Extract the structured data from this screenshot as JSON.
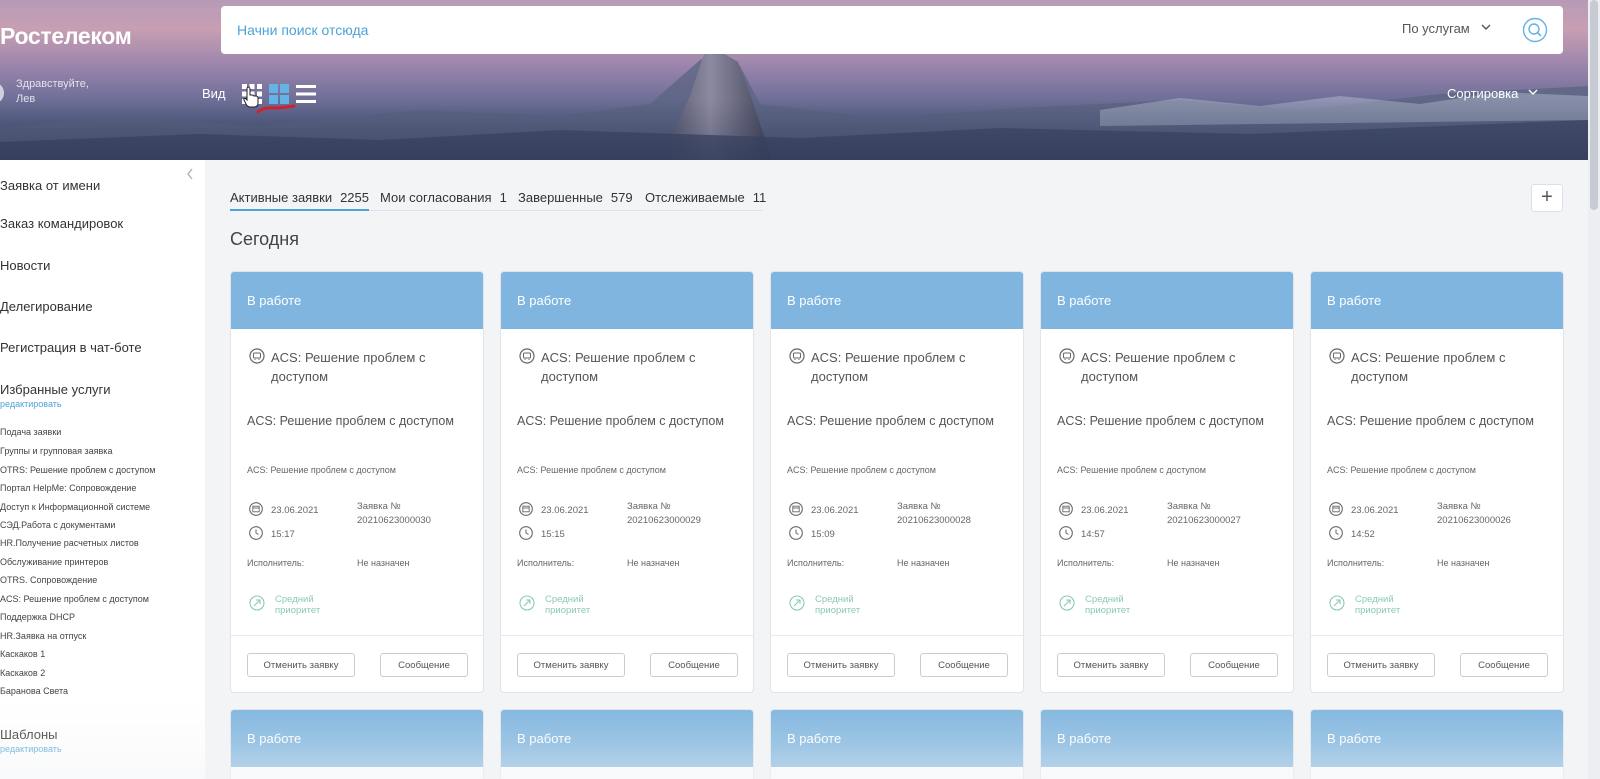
{
  "header": {
    "logo": "Ростелеком",
    "greeting_line1": "Здравствуйте,",
    "greeting_line2": "Лев",
    "view_label": "Вид",
    "search": {
      "placeholder": "Начни поиск отсюда",
      "filter": "По услугам"
    },
    "sort_label": "Сортировка"
  },
  "sidebar": {
    "items": [
      "Заявка от имени",
      "Заказ командировок",
      "Новости",
      "Делегирование",
      "Регистрация в чат-боте",
      "Избранные услуги"
    ],
    "favorites_edit": "редактировать",
    "favorites": [
      "Подача заявки",
      "Группы и групповая заявка",
      "OTRS: Решение проблем с доступом",
      "Портал HelpMe: Сопровождение",
      "Доступ к Информационной системе",
      "СЭД.Работа с документами",
      "HR.Получение расчетных листов",
      "Обслуживание принтеров",
      "OTRS. Сопровождение",
      "ACS: Решение проблем с доступом",
      "Поддержка DHCP",
      "HR.Заявка на отпуск",
      "Каскаков 1",
      "Каскаков 2",
      "Баранова Света"
    ],
    "templates": "Шаблоны",
    "templates_edit": "редактировать"
  },
  "tabs": [
    {
      "label": "Активные заявки",
      "count": "2255"
    },
    {
      "label": "Мои согласования",
      "count": "1"
    },
    {
      "label": "Завершенные",
      "count": "579"
    },
    {
      "label": "Отслеживаемые",
      "count": "11"
    }
  ],
  "add_label": "+",
  "section_title": "Сегодня",
  "cards": [
    {
      "status": "В работе",
      "service": "ACS: Решение проблем с доступом",
      "title": "ACS: Решение проблем с доступом",
      "description": "ACS: Решение проблем с доступом",
      "date": "23.06.2021",
      "time": "15:17",
      "number_label": "Заявка №",
      "number": "20210623000030",
      "executor_label": "Исполнитель:",
      "executor": "Не назначен",
      "priority": "Средний приоритет",
      "cancel": "Отменить заявку",
      "message": "Сообщение"
    },
    {
      "status": "В работе",
      "service": "ACS: Решение проблем с доступом",
      "title": "ACS: Решение проблем с доступом",
      "description": "ACS: Решение проблем с доступом",
      "date": "23.06.2021",
      "time": "15:15",
      "number_label": "Заявка №",
      "number": "20210623000029",
      "executor_label": "Исполнитель:",
      "executor": "Не назначен",
      "priority": "Средний приоритет",
      "cancel": "Отменить заявку",
      "message": "Сообщение"
    },
    {
      "status": "В работе",
      "service": "ACS: Решение проблем с доступом",
      "title": "ACS: Решение проблем с доступом",
      "description": "ACS: Решение проблем с доступом",
      "date": "23.06.2021",
      "time": "15:09",
      "number_label": "Заявка №",
      "number": "20210623000028",
      "executor_label": "Исполнитель:",
      "executor": "Не назначен",
      "priority": "Средний приоритет",
      "cancel": "Отменить заявку",
      "message": "Сообщение"
    },
    {
      "status": "В работе",
      "service": "ACS: Решение проблем с доступом",
      "title": "ACS: Решение проблем с доступом",
      "description": "ACS: Решение проблем с доступом",
      "date": "23.06.2021",
      "time": "14:57",
      "number_label": "Заявка №",
      "number": "20210623000027",
      "executor_label": "Исполнитель:",
      "executor": "Не назначен",
      "priority": "Средний приоритет",
      "cancel": "Отменить заявку",
      "message": "Сообщение"
    },
    {
      "status": "В работе",
      "service": "ACS: Решение проблем с доступом",
      "title": "ACS: Решение проблем с доступом",
      "description": "ACS: Решение проблем с доступом",
      "date": "23.06.2021",
      "time": "14:52",
      "number_label": "Заявка №",
      "number": "20210623000026",
      "executor_label": "Исполнитель:",
      "executor": "Не назначен",
      "priority": "Средний приоритет",
      "cancel": "Отменить заявку",
      "message": "Сообщение"
    }
  ],
  "cards_row2": [
    {
      "status": "В работе"
    },
    {
      "status": "В работе"
    },
    {
      "status": "В работе"
    },
    {
      "status": "В работе"
    },
    {
      "status": "В работе"
    }
  ],
  "icons": {
    "view_grid_small": "grid-small-icon",
    "view_grid_large": "grid-large-icon",
    "view_list": "list-icon",
    "search": "search-icon",
    "service": "service-icon",
    "calendar": "calendar-icon",
    "clock": "clock-icon",
    "priority": "priority-icon"
  },
  "colors": {
    "card_header": "#7fb5de",
    "accent": "#4da3d8",
    "priority": "#8bc9b4"
  }
}
